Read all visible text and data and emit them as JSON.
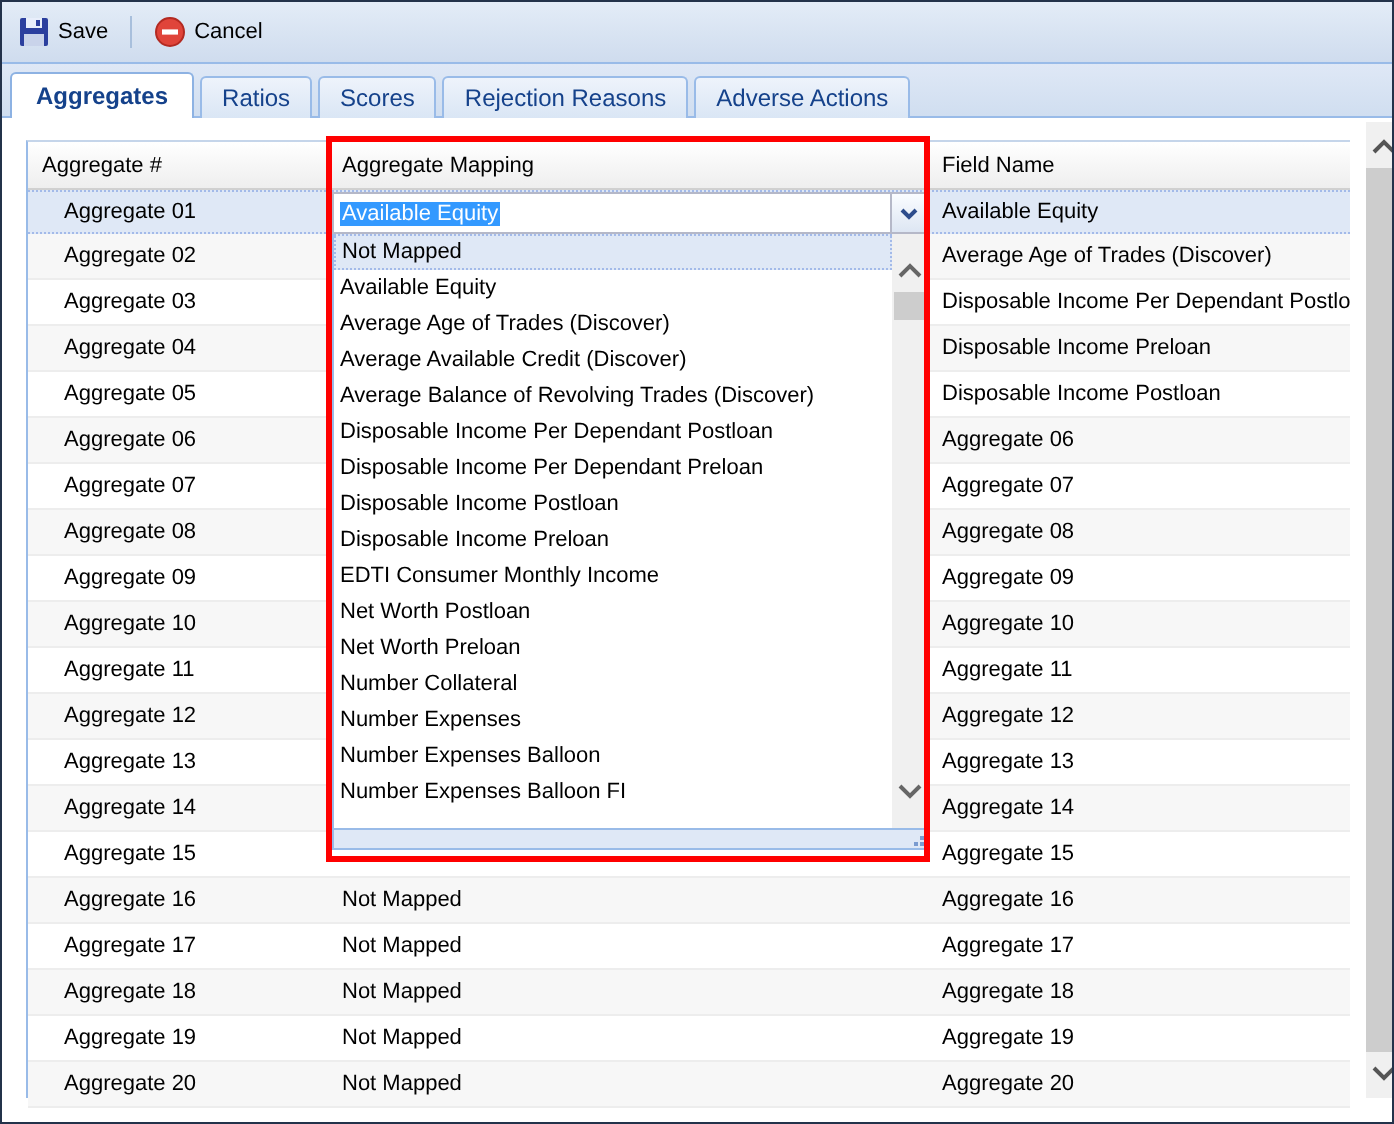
{
  "toolbar": {
    "buttons": [
      {
        "kind": "save",
        "label": "Save"
      },
      {
        "kind": "cancel",
        "label": "Cancel"
      }
    ]
  },
  "tabs": [
    {
      "label": "Aggregates",
      "selected": true
    },
    {
      "label": "Ratios",
      "selected": false
    },
    {
      "label": "Scores",
      "selected": false
    },
    {
      "label": "Rejection Reasons",
      "selected": false
    },
    {
      "label": "Adverse Actions",
      "selected": false
    }
  ],
  "table": {
    "columns": [
      "Aggregate #",
      "Aggregate Mapping",
      "Field Name"
    ],
    "rows": [
      {
        "number": "Aggregate 01",
        "field_name": "Available Equity",
        "selected": true
      },
      {
        "number": "Aggregate 02",
        "field_name": "Average Age of Trades (Discover)",
        "selected": false
      },
      {
        "number": "Aggregate 03",
        "field_name": "Disposable Income Per Dependant Postlo",
        "selected": false
      },
      {
        "number": "Aggregate 04",
        "field_name": "Disposable Income Preloan",
        "selected": false
      },
      {
        "number": "Aggregate 05",
        "field_name": "Disposable Income Postloan",
        "selected": false
      },
      {
        "number": "Aggregate 06",
        "field_name": "Aggregate 06",
        "selected": false
      },
      {
        "number": "Aggregate 07",
        "field_name": "Aggregate 07",
        "selected": false
      },
      {
        "number": "Aggregate 08",
        "field_name": "Aggregate 08",
        "selected": false
      },
      {
        "number": "Aggregate 09",
        "field_name": "Aggregate 09",
        "selected": false
      },
      {
        "number": "Aggregate 10",
        "field_name": "Aggregate 10",
        "selected": false
      },
      {
        "number": "Aggregate 11",
        "field_name": "Aggregate 11",
        "selected": false
      },
      {
        "number": "Aggregate 12",
        "field_name": "Aggregate 12",
        "selected": false
      },
      {
        "number": "Aggregate 13",
        "field_name": "Aggregate 13",
        "selected": false
      },
      {
        "number": "Aggregate 14",
        "field_name": "Aggregate 14",
        "selected": false
      },
      {
        "number": "Aggregate 15",
        "field_name": "Aggregate 15",
        "selected": false
      },
      {
        "number": "Aggregate 16",
        "mapping": "Not Mapped",
        "field_name": "Aggregate 16",
        "selected": false
      },
      {
        "number": "Aggregate 17",
        "mapping": "Not Mapped",
        "field_name": "Aggregate 17",
        "selected": false
      },
      {
        "number": "Aggregate 18",
        "mapping": "Not Mapped",
        "field_name": "Aggregate 18",
        "selected": false
      },
      {
        "number": "Aggregate 19",
        "mapping": "Not Mapped",
        "field_name": "Aggregate 19",
        "selected": false
      },
      {
        "number": "Aggregate 20",
        "mapping": "Not Mapped",
        "field_name": "Aggregate 20",
        "selected": false
      }
    ]
  },
  "mapping_dropdown": {
    "value": "Available Equity",
    "expanded": true,
    "options": [
      {
        "label": "Not Mapped",
        "highlighted": true
      },
      {
        "label": "Available Equity",
        "highlighted": false
      },
      {
        "label": "Average Age of Trades (Discover)",
        "highlighted": false
      },
      {
        "label": "Average Available Credit (Discover)",
        "highlighted": false
      },
      {
        "label": "Average Balance of Revolving Trades (Discover)",
        "highlighted": false
      },
      {
        "label": "Disposable Income Per Dependant Postloan",
        "highlighted": false
      },
      {
        "label": "Disposable Income Per Dependant Preloan",
        "highlighted": false
      },
      {
        "label": "Disposable Income Postloan",
        "highlighted": false
      },
      {
        "label": "Disposable Income Preloan",
        "highlighted": false
      },
      {
        "label": "EDTI Consumer Monthly Income",
        "highlighted": false
      },
      {
        "label": "Net Worth Postloan",
        "highlighted": false
      },
      {
        "label": "Net Worth Preloan",
        "highlighted": false
      },
      {
        "label": "Number Collateral",
        "highlighted": false
      },
      {
        "label": "Number Expenses",
        "highlighted": false
      },
      {
        "label": "Number Expenses Balloon",
        "highlighted": false
      },
      {
        "label": "Number Expenses Balloon FI",
        "highlighted": false
      }
    ]
  }
}
